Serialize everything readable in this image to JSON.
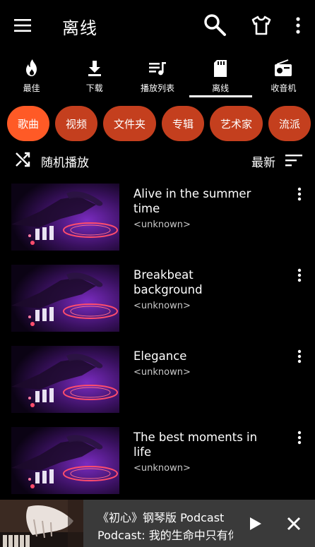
{
  "appbar": {
    "title": "离线"
  },
  "tabs": [
    {
      "label": "最佳",
      "icon": "fire-icon"
    },
    {
      "label": "下载",
      "icon": "download-icon"
    },
    {
      "label": "播放列表",
      "icon": "playlist-icon"
    },
    {
      "label": "离线",
      "icon": "sd-card-icon",
      "active": true
    },
    {
      "label": "收音机",
      "icon": "radio-icon"
    }
  ],
  "chips": [
    {
      "label": "歌曲",
      "active": true
    },
    {
      "label": "视频"
    },
    {
      "label": "文件夹"
    },
    {
      "label": "专辑"
    },
    {
      "label": "艺术家"
    },
    {
      "label": "流派"
    }
  ],
  "shuffle": {
    "label": "随机播放",
    "sort_label": "最新"
  },
  "songs": [
    {
      "title": "Alive in the summer time",
      "artist": "<unknown>"
    },
    {
      "title": "Breakbeat background",
      "artist": "<unknown>"
    },
    {
      "title": "Elegance",
      "artist": "<unknown>"
    },
    {
      "title": "The best moments in life",
      "artist": "<unknown>"
    }
  ],
  "player": {
    "line1": "《初心》钢琴版 Podcast",
    "line2": "Podcast: 我的生命中只有你"
  },
  "colors": {
    "background": "#000000",
    "chip": "#c43f1e",
    "chip_active": "#ff5a26",
    "player_info": "#3a3a3a"
  }
}
